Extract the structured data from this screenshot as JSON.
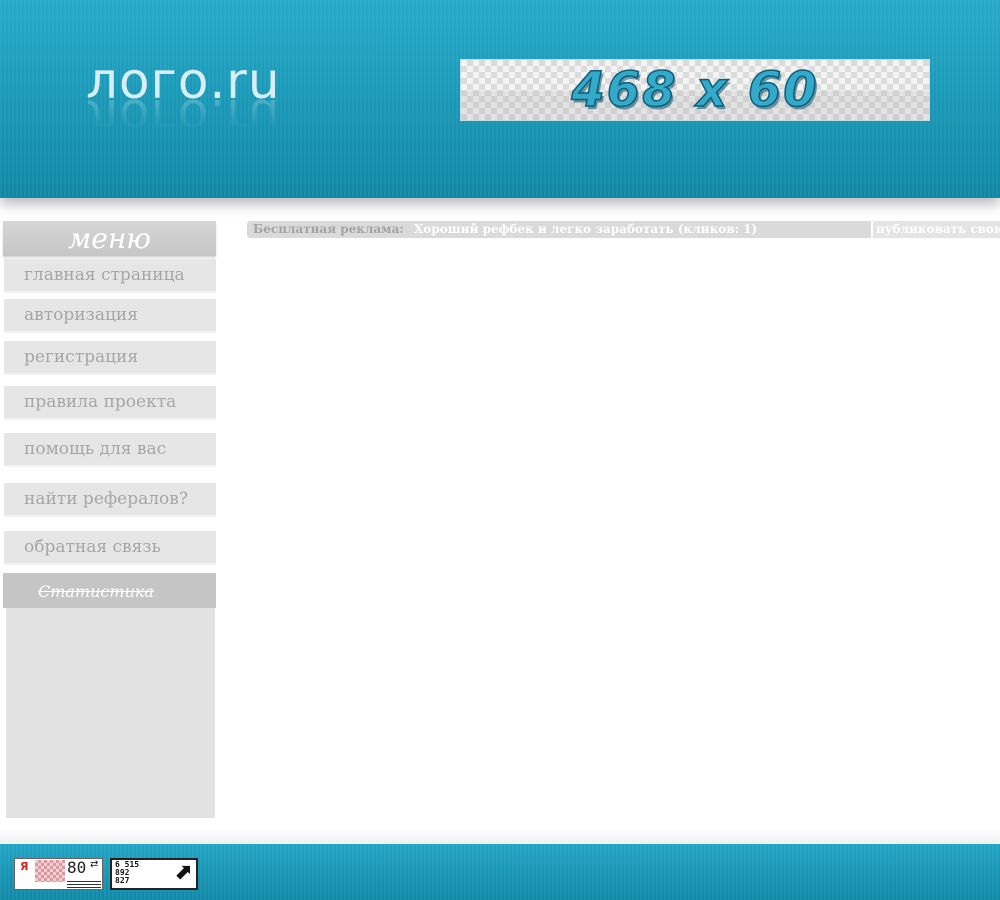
{
  "header": {
    "logo_text": "лого.ru",
    "banner_text": "468 x 60"
  },
  "sidebar": {
    "menu_title": "меню",
    "items": [
      {
        "label": "главная страница"
      },
      {
        "label": "авторизация"
      },
      {
        "label": "регистрация"
      },
      {
        "label": "правила проекта"
      },
      {
        "label": "помощь для вас"
      },
      {
        "label": "найти рефералов?"
      },
      {
        "label": "обратная связь"
      }
    ],
    "stats_title": "Статистика"
  },
  "adbar": {
    "label": "Бесплатная реклама:",
    "link_text": "Хороший рефбек и легко заработать (кликов: 1)",
    "publish_text": "публиковать свою"
  },
  "footer": {
    "yandex_counter": {
      "letter": "Я",
      "value": "80",
      "refresh": "⇄"
    },
    "li_counter": {
      "lines": [
        "6 515",
        "892",
        "827"
      ],
      "arrow": "⬈"
    }
  },
  "colors": {
    "header_blue": "#1d9ab7",
    "menu_item_bg": "#e6e6e6",
    "menu_text": "#a6a6a6",
    "stats_header_bg": "#c5c5c5"
  }
}
